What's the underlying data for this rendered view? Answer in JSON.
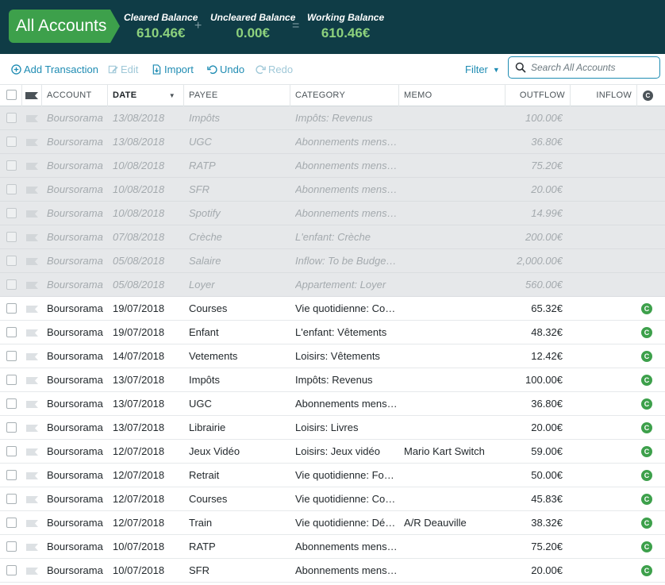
{
  "header": {
    "account_name": "All Accounts",
    "cleared": {
      "label": "Cleared Balance",
      "value": "610.46€"
    },
    "uncleared": {
      "label": "Uncleared Balance",
      "value": "0.00€"
    },
    "working": {
      "label": "Working Balance",
      "value": "610.46€"
    },
    "plus": "+",
    "equals": "=",
    "accent_color": "#3da04b",
    "bg_color": "#0f3c46"
  },
  "toolbar": {
    "add": "Add Transaction",
    "edit": "Edit",
    "import": "Import",
    "undo": "Undo",
    "redo": "Redo",
    "filter": "Filter",
    "search_placeholder": "Search All Accounts"
  },
  "columns": {
    "account": "ACCOUNT",
    "date": "DATE",
    "payee": "PAYEE",
    "category": "CATEGORY",
    "memo": "MEMO",
    "outflow": "OUTFLOW",
    "inflow": "INFLOW",
    "cleared_icon": "C"
  },
  "rows": [
    {
      "scheduled": true,
      "account": "Boursorama",
      "date": "13/08/2018",
      "payee": "Impôts",
      "category": "Impôts: Revenus",
      "memo": "",
      "outflow": "100.00€",
      "inflow": "",
      "cleared": ""
    },
    {
      "scheduled": true,
      "account": "Boursorama",
      "date": "13/08/2018",
      "payee": "UGC",
      "category": "Abonnements mensuel…",
      "memo": "",
      "outflow": "36.80€",
      "inflow": "",
      "cleared": ""
    },
    {
      "scheduled": true,
      "account": "Boursorama",
      "date": "10/08/2018",
      "payee": "RATP",
      "category": "Abonnements mensuel…",
      "memo": "",
      "outflow": "75.20€",
      "inflow": "",
      "cleared": ""
    },
    {
      "scheduled": true,
      "account": "Boursorama",
      "date": "10/08/2018",
      "payee": "SFR",
      "category": "Abonnements mensuel…",
      "memo": "",
      "outflow": "20.00€",
      "inflow": "",
      "cleared": ""
    },
    {
      "scheduled": true,
      "account": "Boursorama",
      "date": "10/08/2018",
      "payee": "Spotify",
      "category": "Abonnements mensuel…",
      "memo": "",
      "outflow": "14.99€",
      "inflow": "",
      "cleared": ""
    },
    {
      "scheduled": true,
      "account": "Boursorama",
      "date": "07/08/2018",
      "payee": "Crèche",
      "category": "L'enfant: Crèche",
      "memo": "",
      "outflow": "200.00€",
      "inflow": "",
      "cleared": ""
    },
    {
      "scheduled": true,
      "account": "Boursorama",
      "date": "05/08/2018",
      "payee": "Salaire",
      "category": "Inflow: To be Budgeted",
      "memo": "",
      "outflow": "2,000.00€",
      "inflow": "",
      "cleared": ""
    },
    {
      "scheduled": true,
      "account": "Boursorama",
      "date": "05/08/2018",
      "payee": "Loyer",
      "category": "Appartement: Loyer",
      "memo": "",
      "outflow": "560.00€",
      "inflow": "",
      "cleared": ""
    },
    {
      "scheduled": false,
      "account": "Boursorama",
      "date": "19/07/2018",
      "payee": "Courses",
      "category": "Vie quotidienne: Cou…",
      "memo": "",
      "outflow": "65.32€",
      "inflow": "",
      "cleared": "C"
    },
    {
      "scheduled": false,
      "account": "Boursorama",
      "date": "19/07/2018",
      "payee": "Enfant",
      "category": "L'enfant: Vêtements",
      "memo": "",
      "outflow": "48.32€",
      "inflow": "",
      "cleared": "C"
    },
    {
      "scheduled": false,
      "account": "Boursorama",
      "date": "14/07/2018",
      "payee": "Vetements",
      "category": "Loisirs: Vêtements",
      "memo": "",
      "outflow": "12.42€",
      "inflow": "",
      "cleared": "C"
    },
    {
      "scheduled": false,
      "account": "Boursorama",
      "date": "13/07/2018",
      "payee": "Impôts",
      "category": "Impôts: Revenus",
      "memo": "",
      "outflow": "100.00€",
      "inflow": "",
      "cleared": "C"
    },
    {
      "scheduled": false,
      "account": "Boursorama",
      "date": "13/07/2018",
      "payee": "UGC",
      "category": "Abonnements mensu…",
      "memo": "",
      "outflow": "36.80€",
      "inflow": "",
      "cleared": "C"
    },
    {
      "scheduled": false,
      "account": "Boursorama",
      "date": "13/07/2018",
      "payee": "Librairie",
      "category": "Loisirs: Livres",
      "memo": "",
      "outflow": "20.00€",
      "inflow": "",
      "cleared": "C"
    },
    {
      "scheduled": false,
      "account": "Boursorama",
      "date": "12/07/2018",
      "payee": "Jeux Vidéo",
      "category": "Loisirs: Jeux vidéo",
      "memo": "Mario Kart Switch",
      "outflow": "59.00€",
      "inflow": "",
      "cleared": "C"
    },
    {
      "scheduled": false,
      "account": "Boursorama",
      "date": "12/07/2018",
      "payee": "Retrait",
      "category": "Vie quotidienne: Fou…",
      "memo": "",
      "outflow": "50.00€",
      "inflow": "",
      "cleared": "C"
    },
    {
      "scheduled": false,
      "account": "Boursorama",
      "date": "12/07/2018",
      "payee": "Courses",
      "category": "Vie quotidienne: Cou…",
      "memo": "",
      "outflow": "45.83€",
      "inflow": "",
      "cleared": "C"
    },
    {
      "scheduled": false,
      "account": "Boursorama",
      "date": "12/07/2018",
      "payee": "Train",
      "category": "Vie quotidienne: Dép…",
      "memo": "A/R Deauville",
      "outflow": "38.32€",
      "inflow": "",
      "cleared": "C"
    },
    {
      "scheduled": false,
      "account": "Boursorama",
      "date": "10/07/2018",
      "payee": "RATP",
      "category": "Abonnements mensu…",
      "memo": "",
      "outflow": "75.20€",
      "inflow": "",
      "cleared": "C"
    },
    {
      "scheduled": false,
      "account": "Boursorama",
      "date": "10/07/2018",
      "payee": "SFR",
      "category": "Abonnements mensu…",
      "memo": "",
      "outflow": "20.00€",
      "inflow": "",
      "cleared": "C"
    }
  ]
}
